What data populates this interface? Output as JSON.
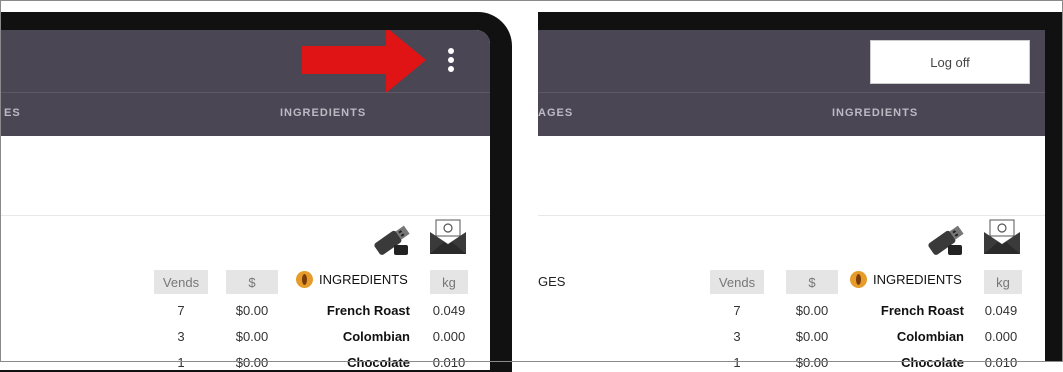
{
  "left_panel": {
    "tab_partial": "ES",
    "tab_ingredients": "INGREDIENTS",
    "icons": [
      "usb-drive-icon",
      "email-icon",
      "kebab-menu-icon",
      "red-arrow-icon"
    ]
  },
  "right_panel": {
    "tab_partial": "AGES",
    "tab_ingredients": "INGREDIENTS",
    "logoff_label": "Log off",
    "row_label": "GES"
  },
  "table": {
    "headers": {
      "vends": "Vends",
      "price": "$",
      "ingredients": "INGREDIENTS",
      "kg": "kg"
    },
    "rows": [
      {
        "vends": "7",
        "price": "$0.00",
        "ingredient": "French Roast",
        "kg": "0.049"
      },
      {
        "vends": "3",
        "price": "$0.00",
        "ingredient": "Colombian",
        "kg": "0.000"
      },
      {
        "vends": "1",
        "price": "$0.00",
        "ingredient": "Chocolate",
        "kg": "0.010"
      }
    ]
  },
  "colors": {
    "header_bg": "#4a4654",
    "arrow": "#e01414",
    "coffee_badge": "#e59c2a"
  }
}
